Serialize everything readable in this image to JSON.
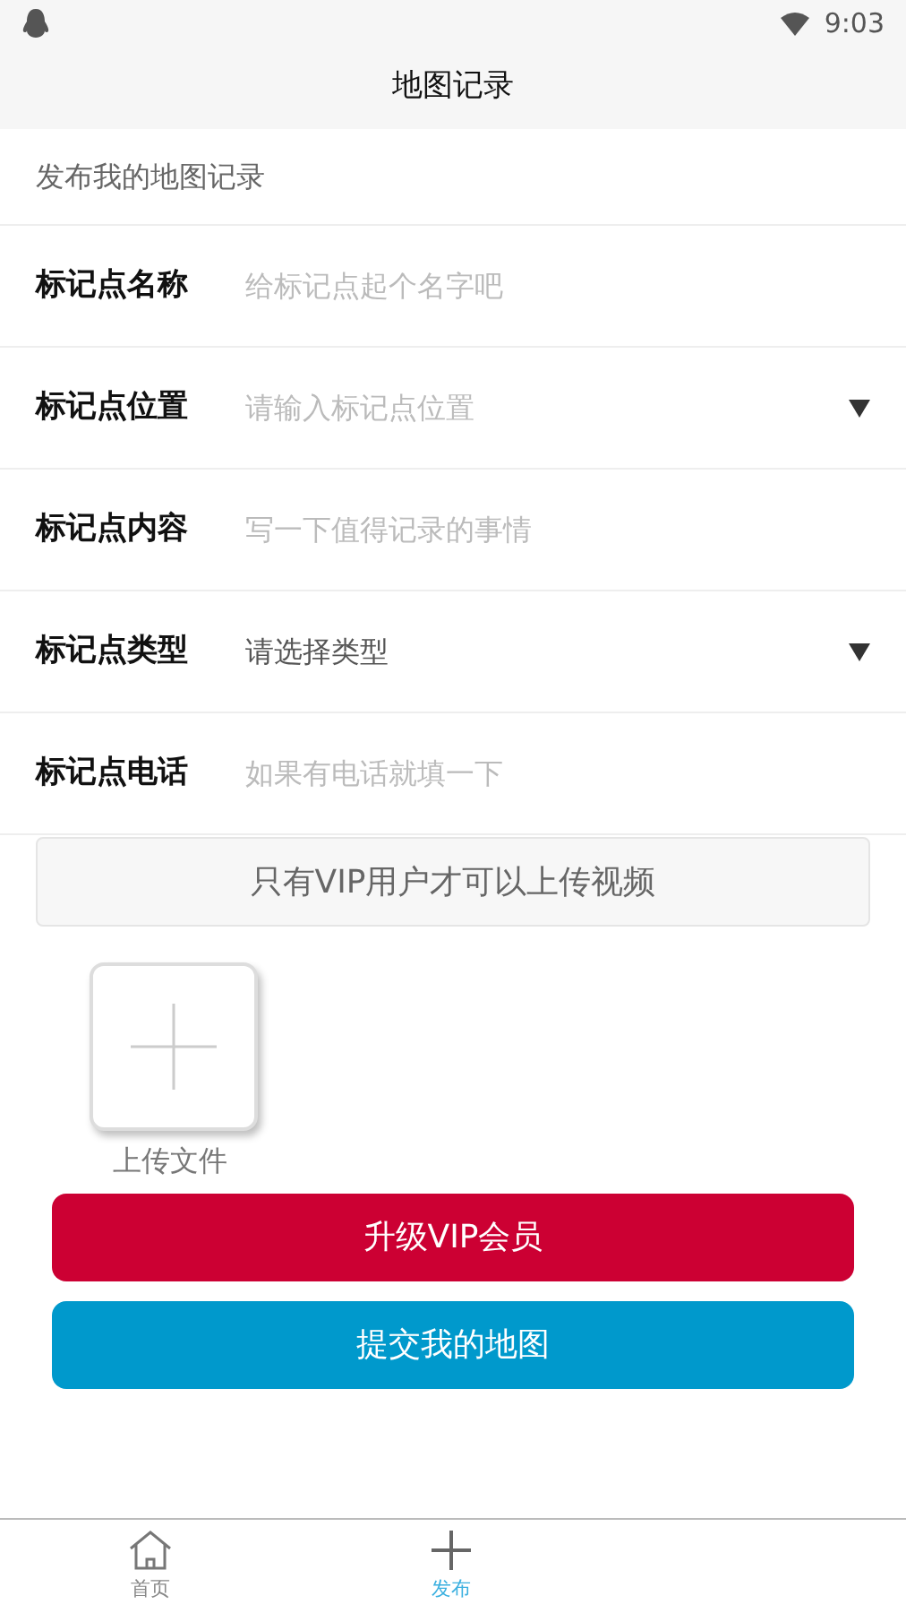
{
  "status_bar": {
    "time": "9:03"
  },
  "header": {
    "title": "地图记录"
  },
  "section_title": "发布我的地图记录",
  "fields": [
    {
      "label": "标记点名称",
      "placeholder": "给标记点起个名字吧",
      "kind": "text"
    },
    {
      "label": "标记点位置",
      "placeholder": "请输入标记点位置",
      "kind": "select"
    },
    {
      "label": "标记点内容",
      "placeholder": "写一下值得记录的事情",
      "kind": "text"
    },
    {
      "label": "标记点类型",
      "value": "请选择类型",
      "kind": "select"
    },
    {
      "label": "标记点电话",
      "placeholder": "如果有电话就填一下",
      "kind": "text"
    }
  ],
  "video_notice": "只有VIP用户才可以上传视频",
  "upload": {
    "label": "上传文件"
  },
  "buttons": [
    {
      "label": "升级VIP会员",
      "kind": "vip"
    },
    {
      "label": "提交我的地图",
      "kind": "submit"
    }
  ],
  "tab_bar": [
    {
      "label": "首页",
      "kind": "home",
      "selected": false
    },
    {
      "label": "发布",
      "kind": "publish",
      "selected": true
    }
  ]
}
